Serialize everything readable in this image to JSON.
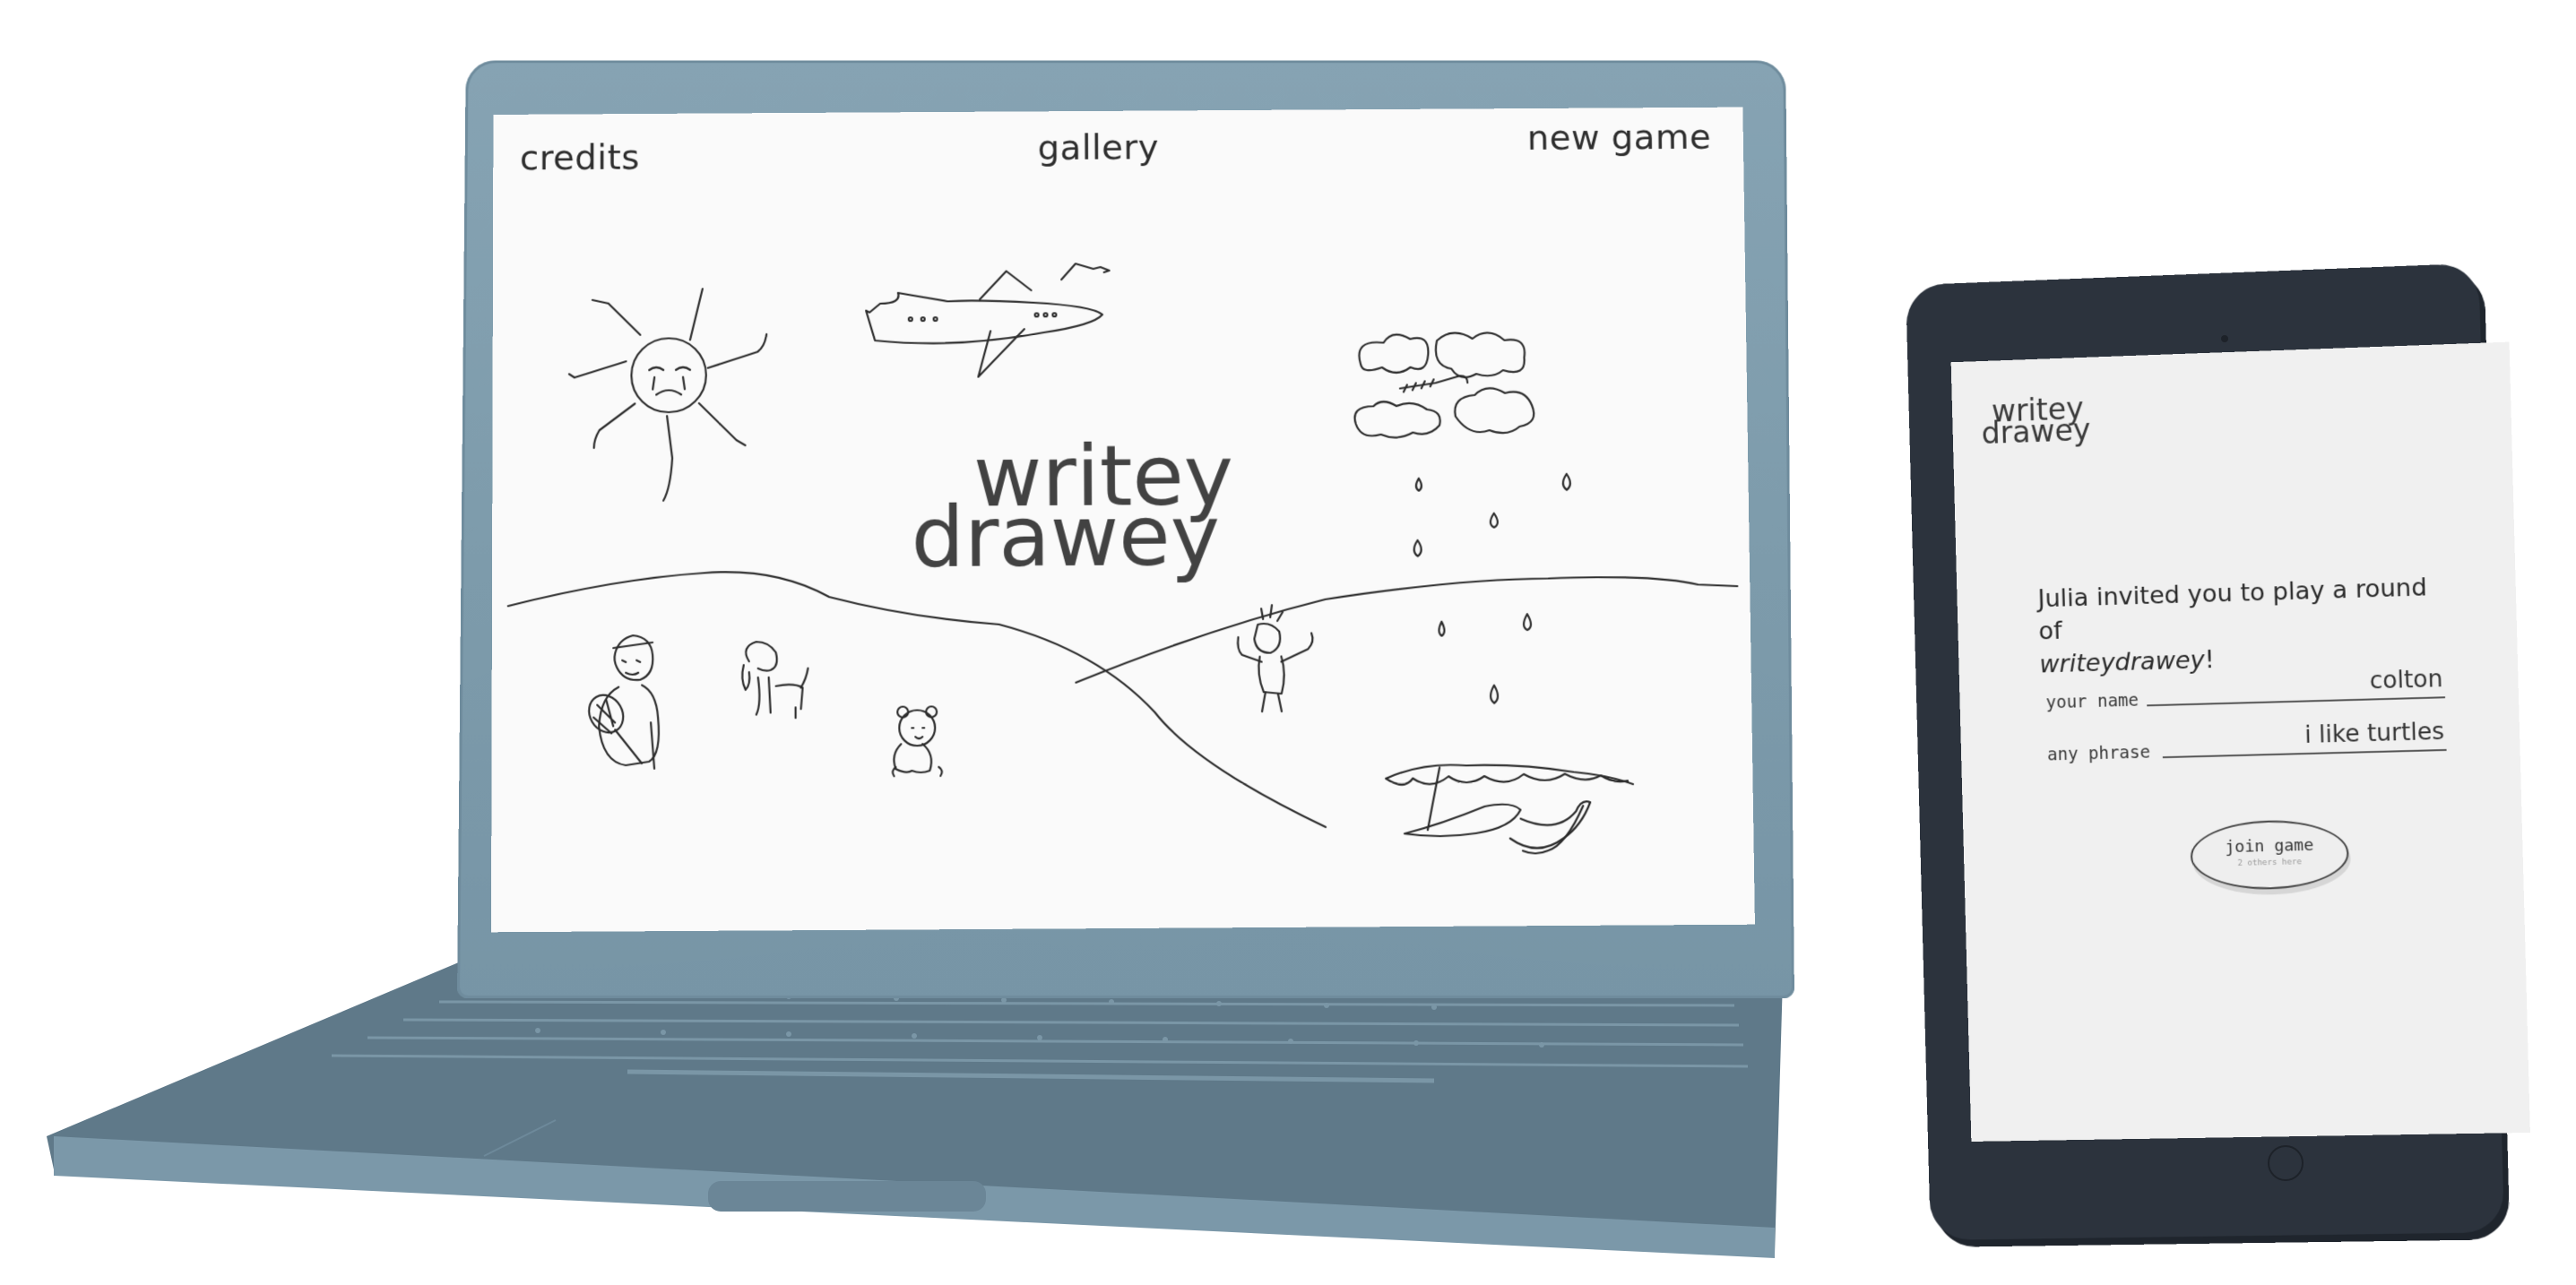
{
  "laptop": {
    "nav": {
      "credits": "credits",
      "gallery": "gallery",
      "new_game": "new game"
    },
    "logo": {
      "line1": "writey",
      "line2": "drawey"
    }
  },
  "tablet": {
    "logo": {
      "line1": "writey",
      "line2": "drawey"
    },
    "invite": {
      "text": "Julia invited you to play a round of",
      "brand": "writeydrawey",
      "suffix": "!"
    },
    "form": {
      "name_label": "your name",
      "name_value": "colton",
      "phrase_label": "any phrase",
      "phrase_value": "i like turtles"
    },
    "join": {
      "label": "join game",
      "sub": "2 others here"
    }
  },
  "colors": {
    "laptop_body": "#7d9bab",
    "laptop_deck": "#5f7989",
    "tablet_body": "#2c333d",
    "screen_bg": "#fafafa",
    "ink": "#2e2e2e"
  }
}
